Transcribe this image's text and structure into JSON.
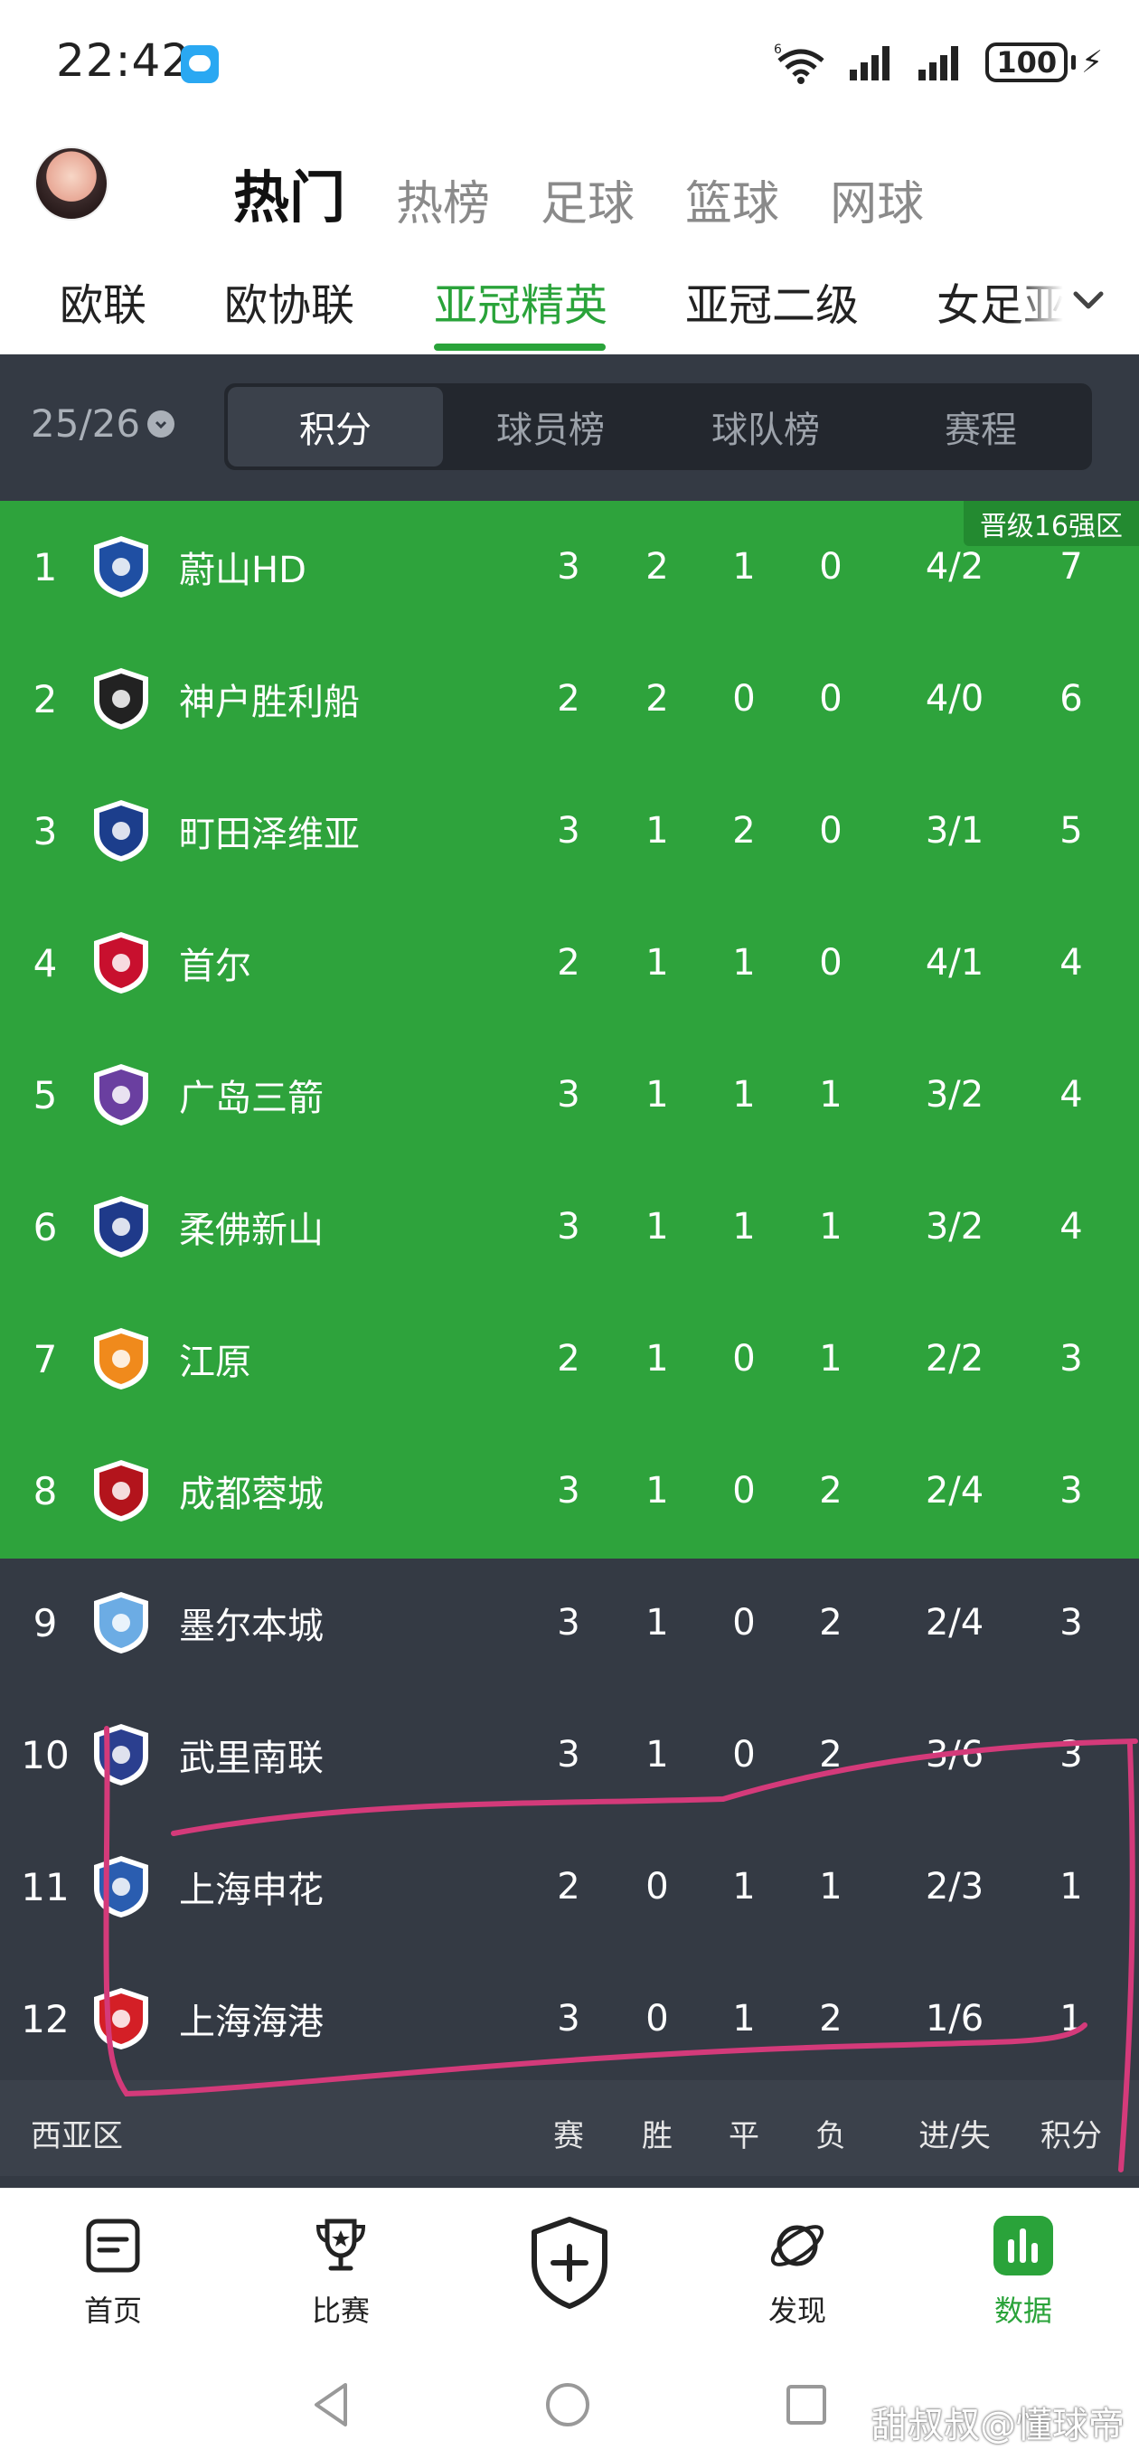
{
  "status": {
    "time": "22:42",
    "wifi_badge": "6",
    "battery": "100"
  },
  "header": {
    "tabs": [
      {
        "label": "热门",
        "active": true
      },
      {
        "label": "热榜",
        "active": false
      },
      {
        "label": "足球",
        "active": false
      },
      {
        "label": "篮球",
        "active": false
      },
      {
        "label": "网球",
        "active": false
      }
    ]
  },
  "leagues": [
    {
      "label": "欧联",
      "active": false
    },
    {
      "label": "欧协联",
      "active": false
    },
    {
      "label": "亚冠精英",
      "active": true
    },
    {
      "label": "亚冠二级",
      "active": false
    },
    {
      "label": "女足亚",
      "active": false
    }
  ],
  "season": "25/26",
  "segments": [
    {
      "label": "积分",
      "active": true
    },
    {
      "label": "球员榜",
      "active": false
    },
    {
      "label": "球队榜",
      "active": false
    },
    {
      "label": "赛程",
      "active": false
    }
  ],
  "zone_badge": "晋级16强区",
  "rows": [
    {
      "rank": "1",
      "team": "蔚山HD",
      "p": "3",
      "w": "2",
      "d": "1",
      "l": "0",
      "gd": "4/2",
      "pts": "7",
      "logo_color": "#1f4fa3"
    },
    {
      "rank": "2",
      "team": "神户胜利船",
      "p": "2",
      "w": "2",
      "d": "0",
      "l": "0",
      "gd": "4/0",
      "pts": "6",
      "logo_color": "#222222"
    },
    {
      "rank": "3",
      "team": "町田泽维亚",
      "p": "3",
      "w": "1",
      "d": "2",
      "l": "0",
      "gd": "3/1",
      "pts": "5",
      "logo_color": "#1c3e8c"
    },
    {
      "rank": "4",
      "team": "首尔",
      "p": "2",
      "w": "1",
      "d": "1",
      "l": "0",
      "gd": "4/1",
      "pts": "4",
      "logo_color": "#c8102e"
    },
    {
      "rank": "5",
      "team": "广岛三箭",
      "p": "3",
      "w": "1",
      "d": "1",
      "l": "1",
      "gd": "3/2",
      "pts": "4",
      "logo_color": "#6a3fa0"
    },
    {
      "rank": "6",
      "team": "柔佛新山",
      "p": "3",
      "w": "1",
      "d": "1",
      "l": "1",
      "gd": "3/2",
      "pts": "4",
      "logo_color": "#1f3a8a"
    },
    {
      "rank": "7",
      "team": "江原",
      "p": "2",
      "w": "1",
      "d": "0",
      "l": "1",
      "gd": "2/2",
      "pts": "3",
      "logo_color": "#f08a1c"
    },
    {
      "rank": "8",
      "team": "成都蓉城",
      "p": "3",
      "w": "1",
      "d": "0",
      "l": "2",
      "gd": "2/4",
      "pts": "3",
      "logo_color": "#b3141c"
    },
    {
      "rank": "9",
      "team": "墨尔本城",
      "p": "3",
      "w": "1",
      "d": "0",
      "l": "2",
      "gd": "2/4",
      "pts": "3",
      "logo_color": "#6cace4"
    },
    {
      "rank": "10",
      "team": "武里南联",
      "p": "3",
      "w": "1",
      "d": "0",
      "l": "2",
      "gd": "3/6",
      "pts": "3",
      "logo_color": "#2b3f8f"
    },
    {
      "rank": "11",
      "team": "上海申花",
      "p": "2",
      "w": "0",
      "d": "1",
      "l": "1",
      "gd": "2/3",
      "pts": "1",
      "logo_color": "#2a5db0"
    },
    {
      "rank": "12",
      "team": "上海海港",
      "p": "3",
      "w": "0",
      "d": "1",
      "l": "2",
      "gd": "1/6",
      "pts": "1",
      "logo_color": "#d41f26"
    }
  ],
  "footer": {
    "region": "西亚区",
    "h_p": "赛",
    "h_w": "胜",
    "h_d": "平",
    "h_l": "负",
    "h_gd": "进/失",
    "h_pts": "积分"
  },
  "nav": [
    {
      "label": "首页",
      "icon": "home-doc-icon",
      "active": false
    },
    {
      "label": "比赛",
      "icon": "trophy-icon",
      "active": false
    },
    {
      "label": "发现",
      "icon": "planet-icon",
      "active": false
    },
    {
      "label": "数据",
      "icon": "bar-chart-icon",
      "active": true
    }
  ],
  "watermark": "甜叔叔@懂球帝",
  "colors": {
    "accent": "#2aa33a",
    "qualify_zone": "#2ea33c",
    "panel": "#343a44",
    "annotation": "#d43a7a"
  }
}
